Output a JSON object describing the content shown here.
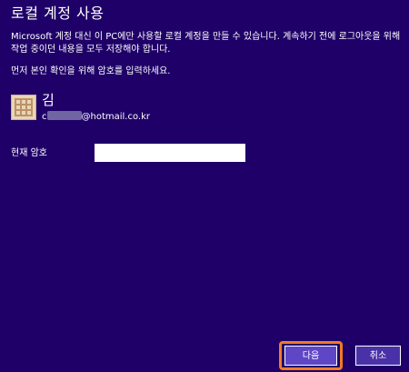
{
  "window": {
    "title": "로컬 계정 사용",
    "description": "Microsoft 계정 대신 이 PC에만 사용할 로컬 계정을 만들 수 있습니다. 계속하기 전에 로그아웃을 위해 작업 중이던 내용을 모두 저장해야 합니다.",
    "prompt": "먼저 본인 확인을 위해 암호를 입력하세요."
  },
  "account": {
    "name": "김",
    "email_prefix_visible": "c",
    "email_suffix": "@hotmail.co.kr",
    "avatar_icon": "account-avatar-icon"
  },
  "password": {
    "label": "현재 암호",
    "value": "",
    "placeholder": ""
  },
  "buttons": {
    "next": "다음",
    "cancel": "취소"
  },
  "colors": {
    "background": "#1f0068",
    "next_button": "#5f46c7",
    "cancel_button": "#4a31a8",
    "highlight": "#f27a24"
  }
}
